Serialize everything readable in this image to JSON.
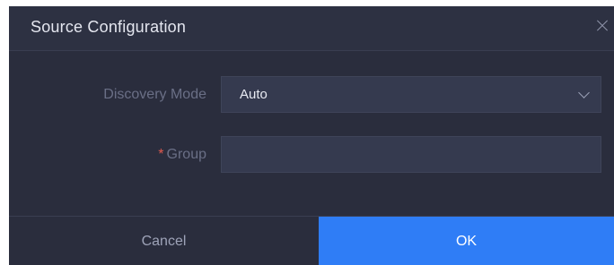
{
  "dialog": {
    "title": "Source Configuration",
    "close_icon": "close-icon"
  },
  "form": {
    "discovery_mode": {
      "label": "Discovery Mode",
      "value": "Auto",
      "icon": "chevron-down-icon"
    },
    "group": {
      "required_mark": "*",
      "label": "Group",
      "value": "",
      "placeholder": ""
    }
  },
  "footer": {
    "cancel_label": "Cancel",
    "ok_label": "OK"
  },
  "colors": {
    "dialog_bg": "#2a2d3d",
    "field_bg": "#353a4f",
    "primary": "#2f7df6",
    "required": "#e05a4f"
  }
}
